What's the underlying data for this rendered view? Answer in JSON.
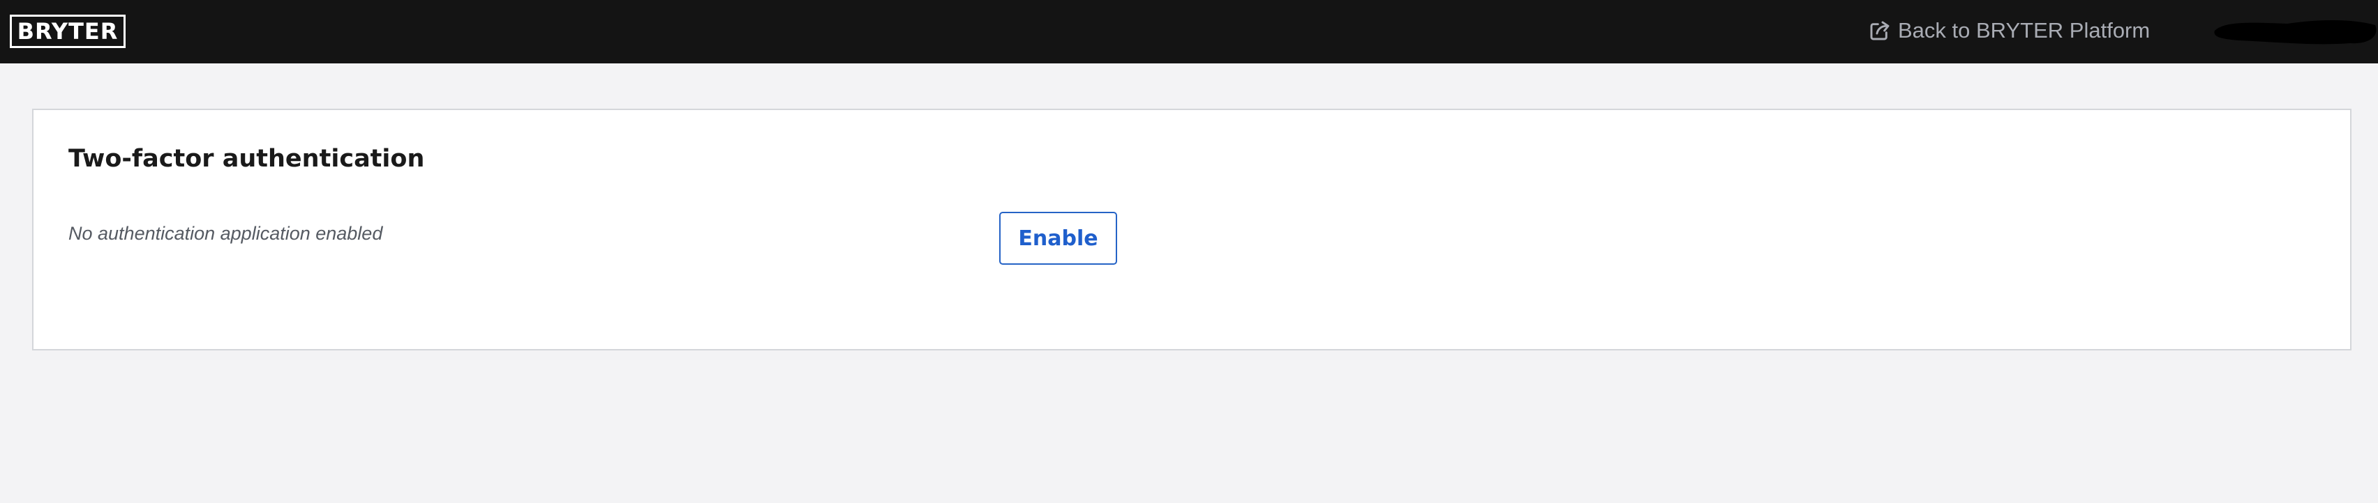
{
  "header": {
    "logo_text": "BRYTER",
    "back_link_label": "Back to BRYTER Platform",
    "back_link_icon": "external-link-icon",
    "user_name_redacted": true
  },
  "two_factor": {
    "title": "Two-factor authentication",
    "status_text": "No authentication application enabled",
    "enable_label": "Enable"
  },
  "colors": {
    "header_bg": "#141414",
    "page_bg": "#f3f3f5",
    "card_bg": "#ffffff",
    "card_border": "#d4d6da",
    "link_muted": "#a9acb4",
    "accent_blue": "#1f5fcc",
    "title_text": "#1a1a1a",
    "muted_text": "#555a62"
  }
}
